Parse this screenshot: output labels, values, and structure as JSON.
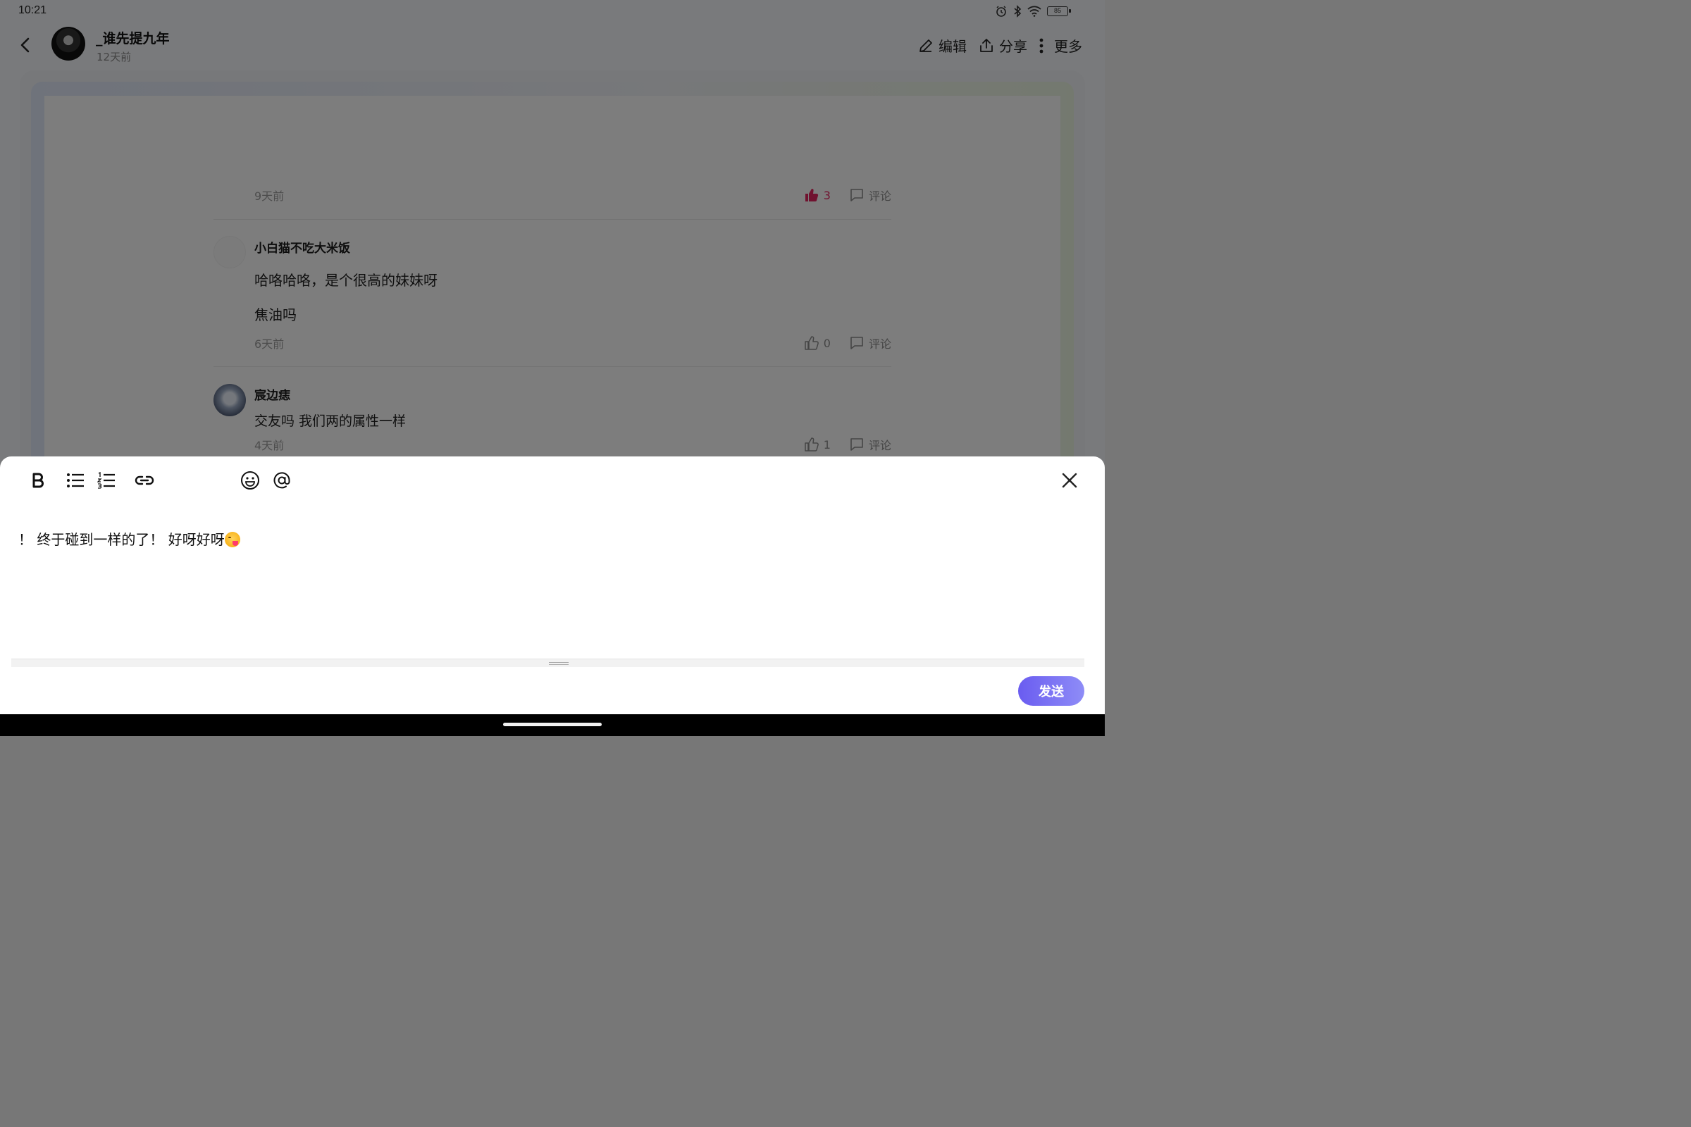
{
  "status_bar": {
    "time": "10:21",
    "battery": "85"
  },
  "header": {
    "author_name": "_谁先提九年",
    "post_time": "12天前",
    "actions": {
      "edit": "编辑",
      "share": "分享",
      "more": "更多"
    }
  },
  "comments": [
    {
      "time": "9天前",
      "likes": "3",
      "liked": true,
      "comment_label": "评论"
    },
    {
      "name": "小白猫不吃大米饭",
      "lines": [
        "哈咯哈咯，是个很高的妹妹呀",
        "焦油吗"
      ],
      "time": "6天前",
      "likes": "0",
      "comment_label": "评论"
    },
    {
      "name": "宸边痣",
      "lines": [
        "交友吗 我们两的属性一样"
      ],
      "time": "4天前",
      "likes": "1",
      "comment_label": "评论"
    }
  ],
  "editor": {
    "toolbar": [
      "bold-icon",
      "bullet-list-icon",
      "numbered-list-icon",
      "link-icon",
      "emoji-icon",
      "mention-icon",
      "close-icon"
    ],
    "text": "！ 终于碰到一样的了！ 好呀好呀",
    "send_label": "发送"
  },
  "colors": {
    "like_active": "#e0245e",
    "send_button": "#6a5cf0"
  }
}
